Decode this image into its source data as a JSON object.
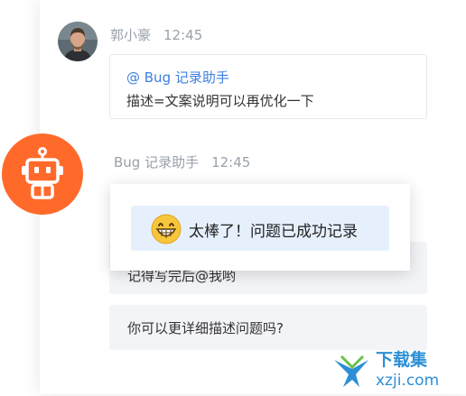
{
  "user_message": {
    "sender": "郭小豪",
    "time": "12:45",
    "mention": "@ Bug 记录助手",
    "text": "描述=文案说明可以再优化一下"
  },
  "bot_reply": {
    "sender": "Bug 记录助手",
    "time": "12:45",
    "partial_bubble_text": "记得写完后@我哟",
    "question_text": "你可以更详细描述问题吗?"
  },
  "popup": {
    "text": "太棒了！问题已成功记录"
  },
  "watermark": {
    "cn": "下载集",
    "url": "xzji.com"
  },
  "colors": {
    "accent_orange": "#ff6a2b",
    "mention_blue": "#3d7fe0",
    "popup_bg": "#e6f0fd"
  }
}
